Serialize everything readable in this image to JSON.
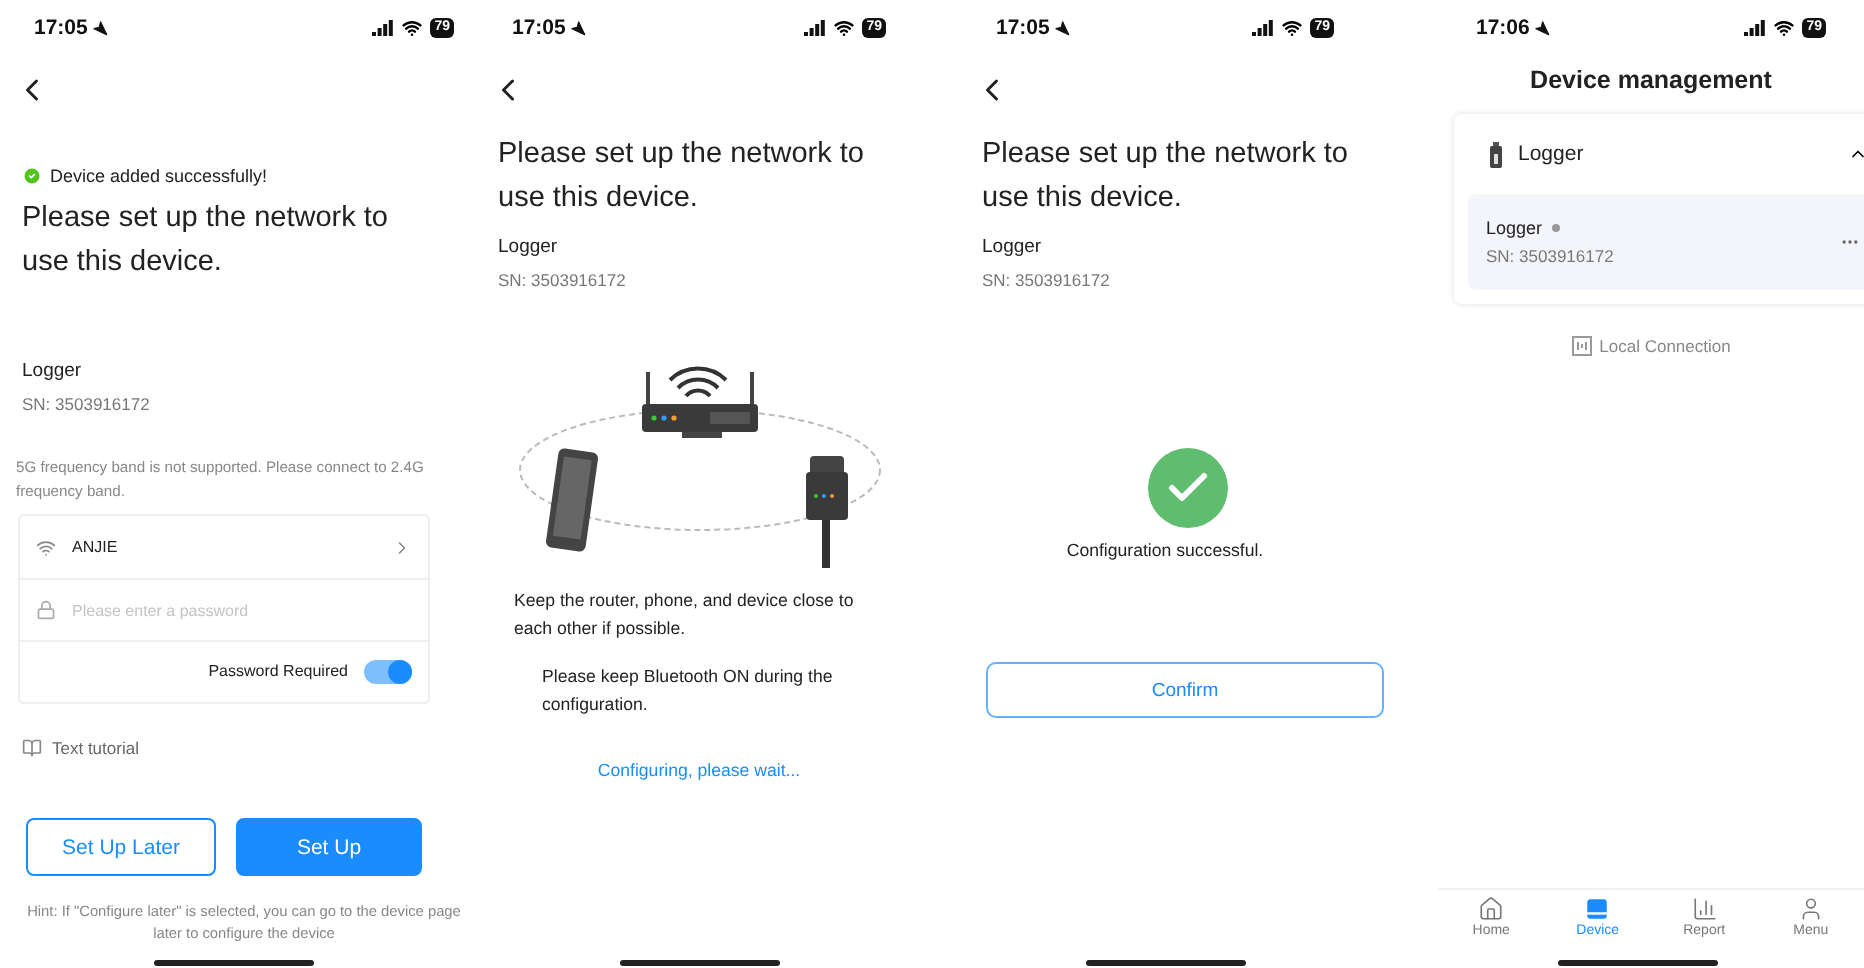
{
  "screens": [
    {
      "kind": "network_setup",
      "status": {
        "time": "17:05",
        "battery": "79"
      },
      "success_message": "Device added successfully!",
      "title": "Please set up the network to use this device.",
      "device_name": "Logger",
      "serial": "SN: 3503916172",
      "notice": "5G frequency band is not supported. Please connect to 2.4G frequency band.",
      "wifi": {
        "network": "ANJIE",
        "password_placeholder": "Please enter a password",
        "password_required_label": "Password Required",
        "password_required": true
      },
      "tutorial_link": "Text tutorial",
      "buttons": [
        {
          "label": "Set Up Later",
          "primary": false
        },
        {
          "label": "Set Up",
          "primary": true
        }
      ],
      "hint": "Hint: If \"Configure later\" is selected, you can go to the device page later to configure the device"
    },
    {
      "kind": "configuring",
      "status": {
        "time": "17:05",
        "battery": "79"
      },
      "title": "Please set up the network to use this device.",
      "device_name": "Logger",
      "serial": "SN: 3503916172",
      "tips": [
        "Keep the router, phone, and device close to each other if possible.",
        "Please keep Bluetooth ON during the configuration."
      ],
      "progress_text": "Configuring, please wait..."
    },
    {
      "kind": "success",
      "status": {
        "time": "17:05",
        "battery": "79"
      },
      "title": "Please set up the network to use this device.",
      "device_name": "Logger",
      "serial": "SN: 3503916172",
      "result_text": "Configuration successful.",
      "button": "Confirm"
    },
    {
      "kind": "device_management",
      "status": {
        "time": "17:06",
        "battery": "79"
      },
      "title": "Device management",
      "group": {
        "name": "Logger",
        "expanded": true,
        "devices": [
          {
            "name": "Logger",
            "online": false,
            "serial": "SN: 3503916172"
          }
        ]
      },
      "local_connection": "Local Connection",
      "tabs": [
        {
          "label": "Home",
          "selected": false
        },
        {
          "label": "Device",
          "selected": true
        },
        {
          "label": "Report",
          "selected": false
        },
        {
          "label": "Menu",
          "selected": false
        }
      ]
    }
  ]
}
